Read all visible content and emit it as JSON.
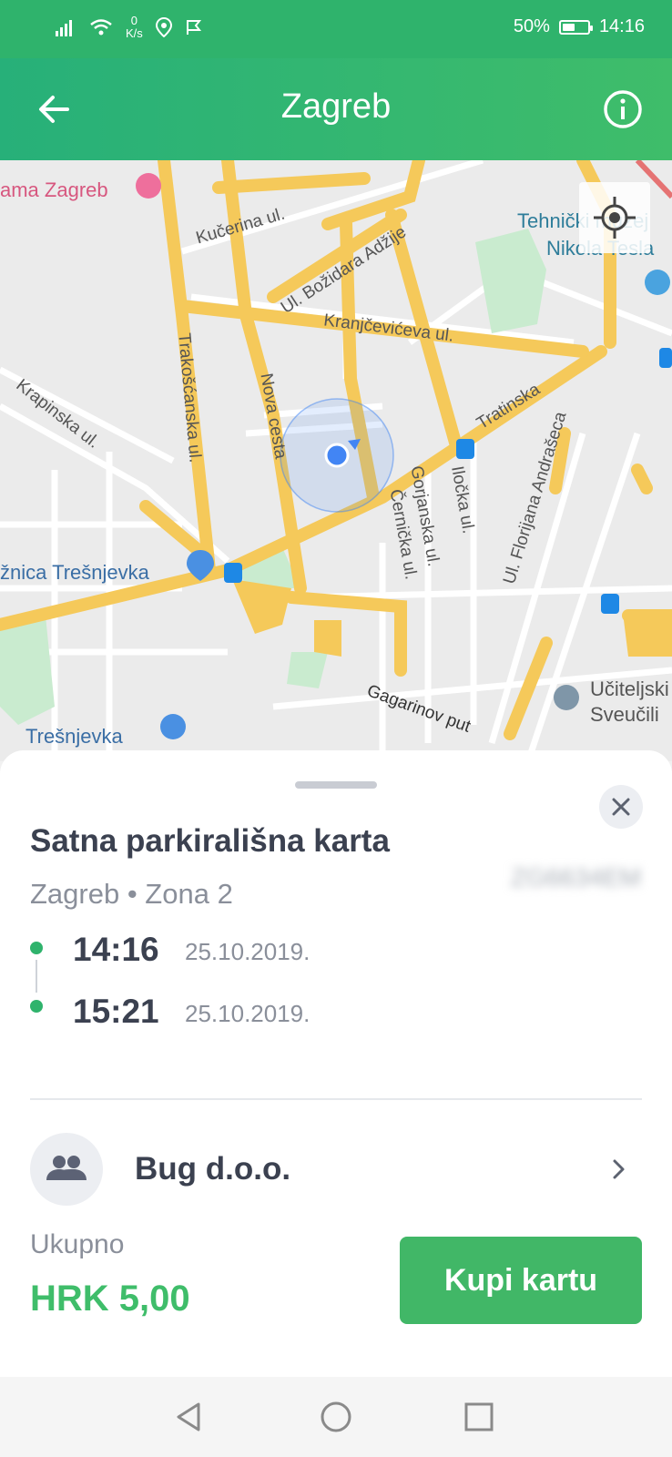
{
  "status_bar": {
    "speed_value": "0",
    "speed_unit": "K/s",
    "battery": "50%",
    "battery_level": 0.5,
    "time": "14:16"
  },
  "header": {
    "title": "Zagreb"
  },
  "map": {
    "labels": {
      "hotel": "ama Zagreb",
      "kucerina": "Kučerina ul.",
      "tehnicki": "Tehnički muzej",
      "tesla": "Nikola Tesla",
      "adzije": "Ul. Božidara Adžije",
      "kranjceviceva": "Kranjčevićeva ul.",
      "krapinska": "Krapinska ul.",
      "trakoscanska": "Trakošćanska ul.",
      "nova_cesta": "Nova cesta",
      "tratinska": "Tratinska",
      "ilocka": "Iločka ul.",
      "gorjanska": "Gorjanska ul.",
      "cernicka": "Černička ul.",
      "andraseca": "Ul. Florijana Andrašeca",
      "tresnjevka_market": "žnica Trešnjevka",
      "gagarinov": "Gagarinov put",
      "uciteljski": "Učiteljski",
      "sveucilis": "Sveučili",
      "tresnjevka_bottom": "Trešnjevka"
    }
  },
  "ticket": {
    "title": "Satna parkirališna karta",
    "subtitle": "Zagreb • Zona 2",
    "plate": "ZG6634EM",
    "start_time": "14:16",
    "start_date": "25.10.2019.",
    "end_time": "15:21",
    "end_date": "25.10.2019."
  },
  "company": {
    "name": "Bug d.o.o."
  },
  "total": {
    "label": "Ukupno",
    "value": "HRK 5,00"
  },
  "buy_button": {
    "label": "Kupi kartu"
  },
  "colors": {
    "brand_green": "#2fb36c",
    "button_green": "#41b767",
    "price_green": "#3fbd6a"
  }
}
